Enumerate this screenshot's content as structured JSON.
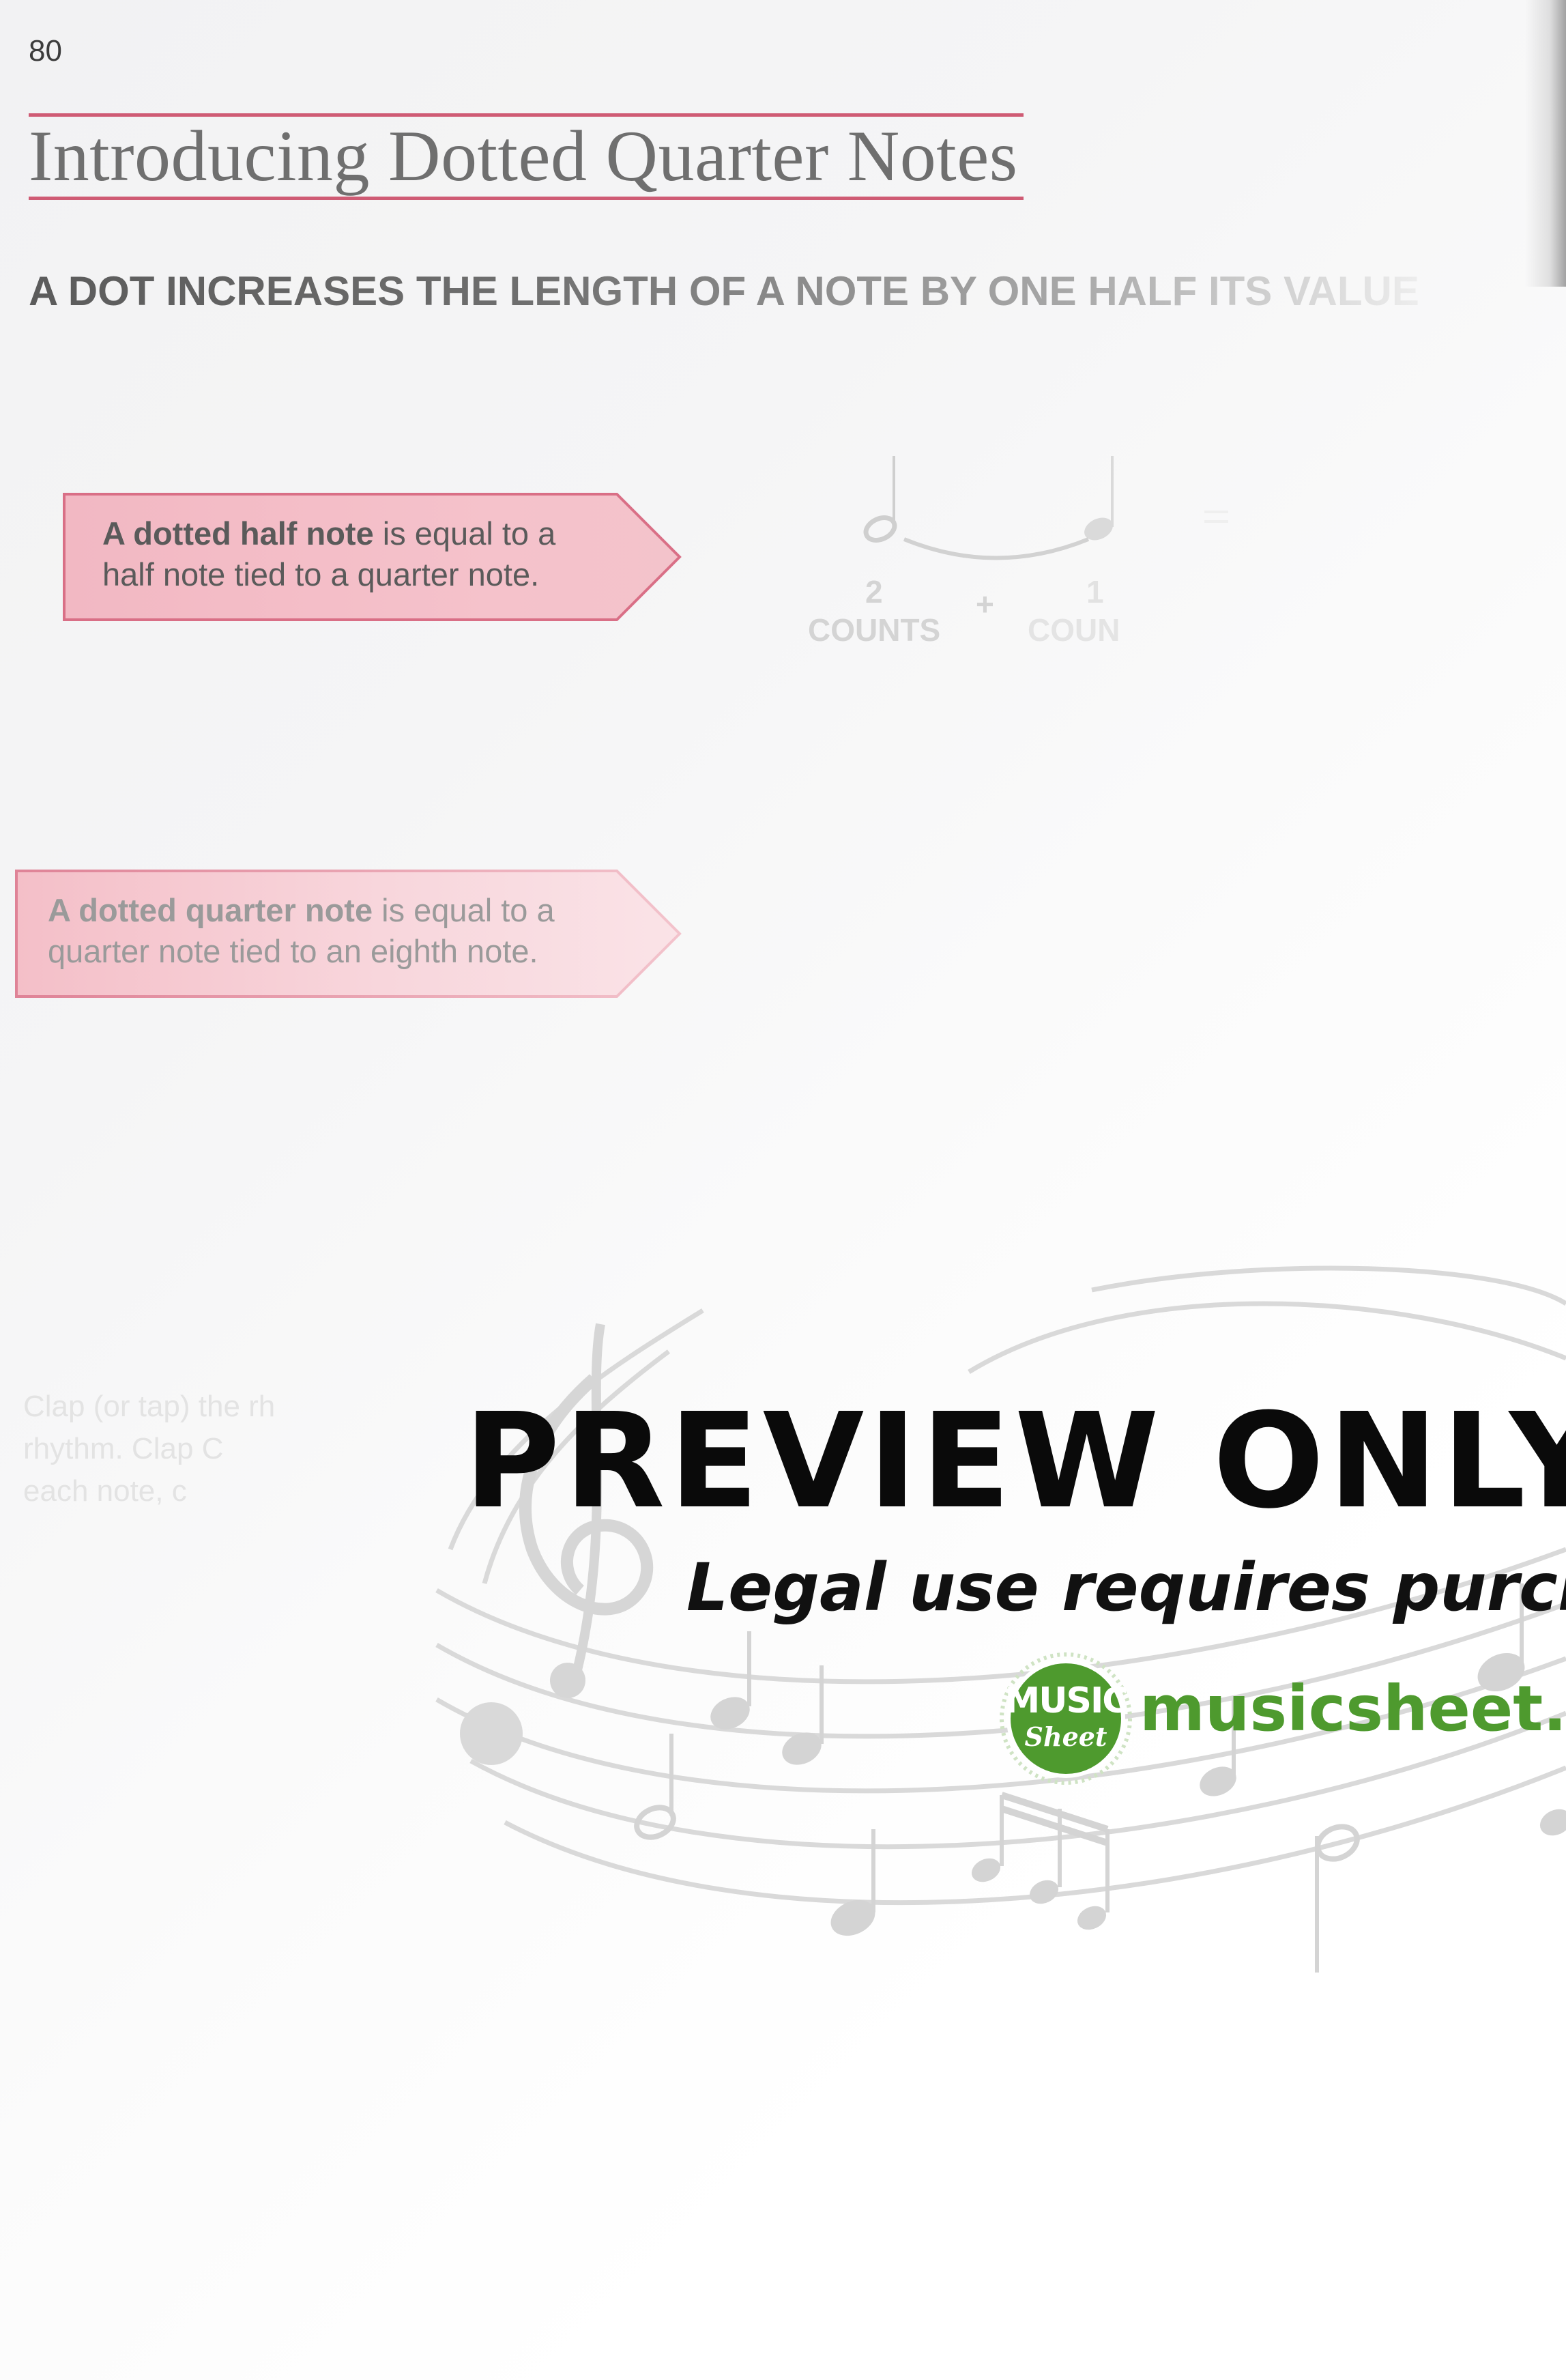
{
  "page": {
    "number": "80",
    "title": "Introducing Dotted Quarter Notes",
    "rule": "A DOT INCREASES THE LENGTH OF A NOTE BY ONE HALF ITS VALUE"
  },
  "callouts": [
    {
      "bold": "A dotted half note",
      "line1_rest": " is equal to a",
      "line2": "half note tied to a quarter note."
    },
    {
      "bold": "A dotted quarter note",
      "line1_rest": " is equal to a",
      "line2": "quarter note tied to an eighth note."
    }
  ],
  "note_demo": {
    "left_count": "2",
    "left_label": "COUNTS",
    "plus": "+",
    "right_count": "1",
    "right_label": "COUN",
    "equals": "="
  },
  "exercise": {
    "text": "Clap (or tap) the rh\nrhythm.  Clap C\neach note, c"
  },
  "watermark": {
    "title": "PREVIEW ONLY",
    "subtitle": "Legal use requires purchase",
    "logo_line1": "MUSIC",
    "logo_line2": "Sheet",
    "site": "musicsheet.org",
    "brand_color": "#4e9a2e"
  }
}
